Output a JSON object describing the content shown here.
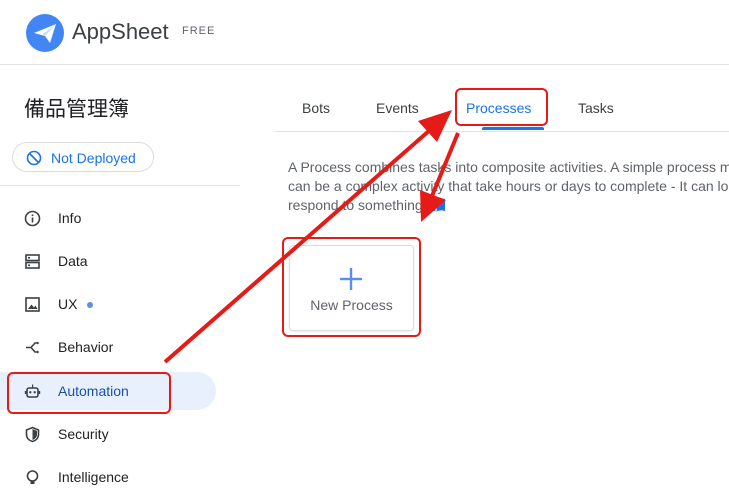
{
  "header": {
    "brand": "AppSheet",
    "plan": "FREE",
    "logo_icon": "paper-plane-logo"
  },
  "sidebar": {
    "app_name": "備品管理簿",
    "deploy_status": "Not Deployed",
    "items": [
      {
        "label": "Info",
        "icon": "info-icon"
      },
      {
        "label": "Data",
        "icon": "data-icon"
      },
      {
        "label": "UX",
        "icon": "image-icon"
      },
      {
        "label": "Behavior",
        "icon": "behavior-icon"
      },
      {
        "label": "Automation",
        "icon": "robot-icon"
      },
      {
        "label": "Security",
        "icon": "shield-icon"
      },
      {
        "label": "Intelligence",
        "icon": "lightbulb-icon"
      }
    ],
    "active_item": "Automation"
  },
  "tabs": {
    "items": [
      "Bots",
      "Events",
      "Processes",
      "Tasks"
    ],
    "active": "Processes"
  },
  "main": {
    "description_lines": [
      "A Process combines tasks into composite activities. A simple process m",
      "can be a complex activity that take hours or days to complete - It can lo",
      "respond to something"
    ],
    "new_process_label": "New Process"
  },
  "colors": {
    "accent": "#1a73e8",
    "active_bg": "#e8f0fe",
    "annotation": "#e41b17"
  }
}
